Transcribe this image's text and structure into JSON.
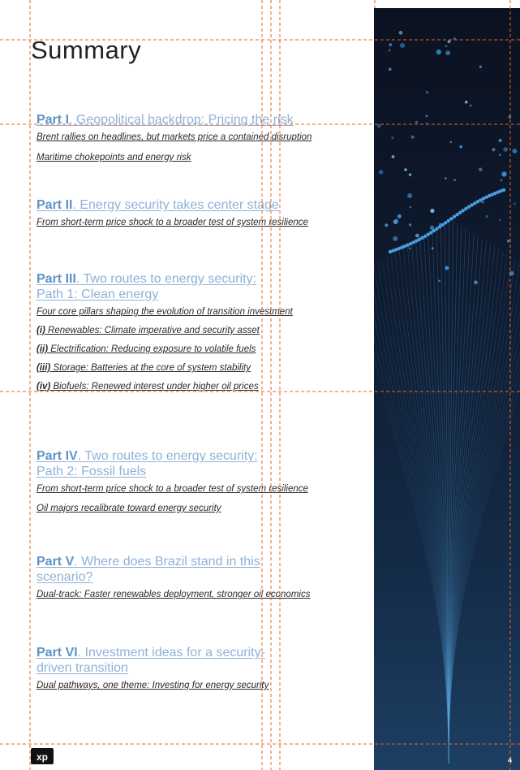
{
  "title": "Summary",
  "parts": [
    {
      "num": "Part I",
      "rest": ". Geopolitical backdrop: Pricing the risk",
      "subs": [
        "Brent rallies on headlines, but markets price a contained disruption",
        "Maritime chokepoints and energy risk"
      ]
    },
    {
      "num": "Part II",
      "rest": ". Energy security takes center stage",
      "subs": [
        "From short-term price shock to a broader test of system resilience"
      ]
    },
    {
      "num": "Part III",
      "rest": ". Two routes to energy security:",
      "rest2": "Path 1: Clean energy",
      "subs": [
        "Four core pillars shaping the evolution of transition investment"
      ]
    },
    {
      "num": "Part IV",
      "rest": ". Two routes to energy security:",
      "rest2": "Path 2: Fossil fuels",
      "subs": [
        "From short-term price shock to a broader test of system resilience",
        "Oil majors recalibrate toward energy security"
      ]
    },
    {
      "num": "Part V",
      "rest": ". Where does Brazil stand in this",
      "rest2": "scenario?",
      "subs": [
        "Dual-track: Faster renewables deployment, stronger oil economics"
      ]
    },
    {
      "num": "Part VI",
      "rest": ". Investment ideas for a security-",
      "rest2": "driven transition",
      "subs": [
        "Dual pathways, one theme: Investing for energy security"
      ]
    }
  ],
  "pillars": [
    {
      "roman": "(i)",
      "text": " Renewables: Climate imperative and security asset"
    },
    {
      "roman": "(ii)",
      "text": " Electrification: Reducing exposure to volatile fuels"
    },
    {
      "roman": "(iii)",
      "text": " Storage: Batteries at the core of system stability"
    },
    {
      "roman": "(iv)",
      "text": " Biofuels: Renewed interest under higher oil prices"
    }
  ],
  "page_number": "4",
  "logo_text": "xp",
  "colors": {
    "part_number": "#5f93c8",
    "part_title": "#8fb1d6",
    "guides": "#e8632a",
    "panel": "#0e1a2e"
  }
}
